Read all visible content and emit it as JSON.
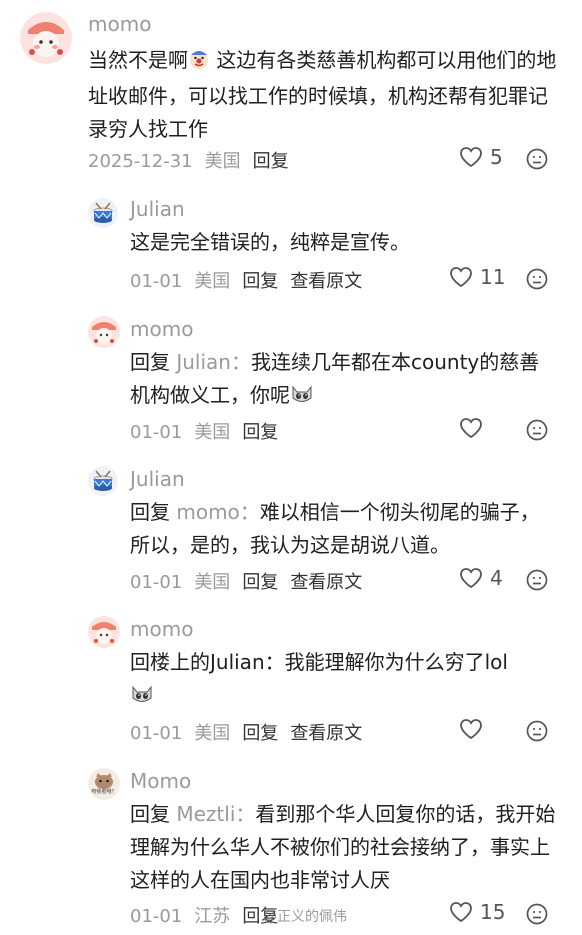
{
  "comments": [
    {
      "user": "momo",
      "text_a": "当然不是啊",
      "text_b": " 这边有各类慈善机构都可以用他们的地址收邮件，可以找工作的时候填，机构还帮有犯罪记录穷人找工作",
      "date": "2025-12-31",
      "location": "美国",
      "reply_label": "回复",
      "likes": "5"
    },
    {
      "user": "Julian",
      "text": "这是完全错误的，纯粹是宣传。",
      "date": "01-01",
      "location": "美国",
      "reply_label": "回复",
      "view_original": "查看原文",
      "likes": "11"
    },
    {
      "user": "momo",
      "reply_prefix": "回复",
      "reply_to": " Julian：",
      "text": "我连续几年都在本county的慈善机构做义工，你呢",
      "date": "01-01",
      "location": "美国",
      "reply_label": "回复",
      "likes": ""
    },
    {
      "user": "Julian",
      "reply_prefix": "回复",
      "reply_to": " momo：",
      "text": "难以相信一个彻头彻尾的骗子，所以，是的，我认为这是胡说八道。",
      "date": "01-01",
      "location": "美国",
      "reply_label": "回复",
      "view_original": "查看原文",
      "likes": "4"
    },
    {
      "user": "momo",
      "text": "回楼上的Julian：我能理解你为什么穷了lol",
      "date": "01-01",
      "location": "美国",
      "reply_label": "回复",
      "view_original": "查看原文",
      "likes": ""
    },
    {
      "user": "Momo",
      "avatar_caption": "吻我者哦？",
      "reply_prefix": "回复",
      "reply_to": " Meztli：",
      "text": "看到那个华人回复你的话，我开始理解为什么华人不被你们的社会接纳了，事实上这样的人在国内也非常讨人厌",
      "date": "01-01",
      "location": "江苏",
      "reply_label": "回复",
      "likes": "15"
    }
  ],
  "watermark": "@正义的佩伟",
  "colors": {
    "text": "#1f1f1f",
    "muted": "#9a9a9a",
    "icon": "#555555"
  },
  "icons": {
    "like": "heart-outline-icon",
    "dislike": "unhappy-face-icon"
  }
}
